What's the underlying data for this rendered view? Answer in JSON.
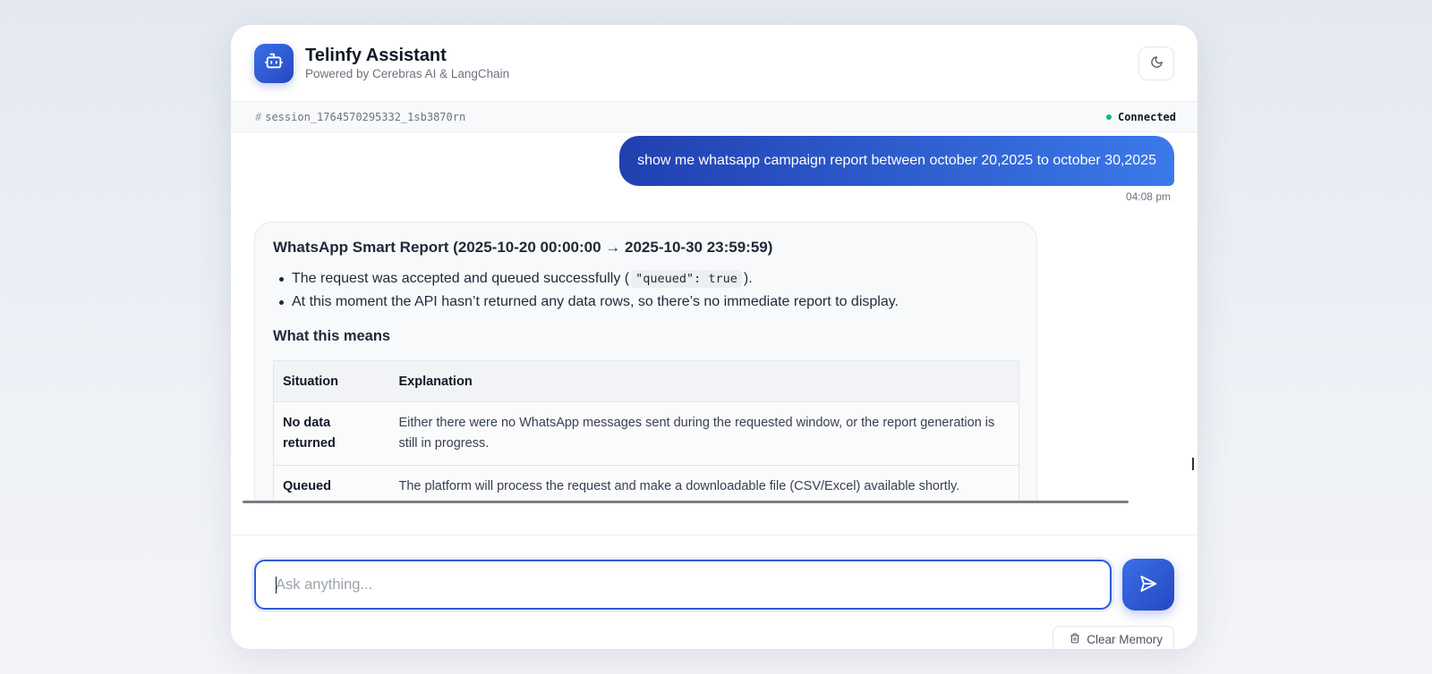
{
  "header": {
    "title": "Telinfy Assistant",
    "subtitle": "Powered by Cerebras AI & LangChain",
    "logo_icon": "robot-icon",
    "theme_toggle_icon": "moon-icon"
  },
  "session": {
    "hash": "#",
    "id": "session_1764570295332_1sb3870rn",
    "status": "Connected",
    "status_color": "#10b981"
  },
  "messages": {
    "user": {
      "text": "show me whatsapp campaign report between october 20,2025 to october 30,2025",
      "time": "04:08 pm"
    },
    "bot": {
      "title": "WhatsApp Smart Report (2025-10-20 00:00:00 → 2025-10-30 23:59:59)",
      "bullet1_before": "The request was accepted and queued successfully (",
      "bullet1_code": "\"queued\": true",
      "bullet1_after": ").",
      "bullet2": "At this moment the API hasn’t returned any data rows, so there’s no immediate report to display.",
      "subheading": "What this means",
      "table": {
        "headers": [
          "Situation",
          "Explanation"
        ],
        "rows": [
          [
            "No data returned",
            "Either there were no WhatsApp messages sent during the requested window, or the report generation is still in progress."
          ],
          [
            "Queued",
            "The platform will process the request and make a downloadable file (CSV/Excel) available shortly."
          ]
        ]
      }
    }
  },
  "composer": {
    "placeholder": "Ask anything...",
    "send_icon": "send-icon",
    "clear_label": "Clear Memory",
    "clear_icon": "trash-icon"
  },
  "colors": {
    "accent": "#2c5ad8",
    "user_bubble_start": "#2140b0",
    "user_bubble_end": "#3b79ea"
  }
}
